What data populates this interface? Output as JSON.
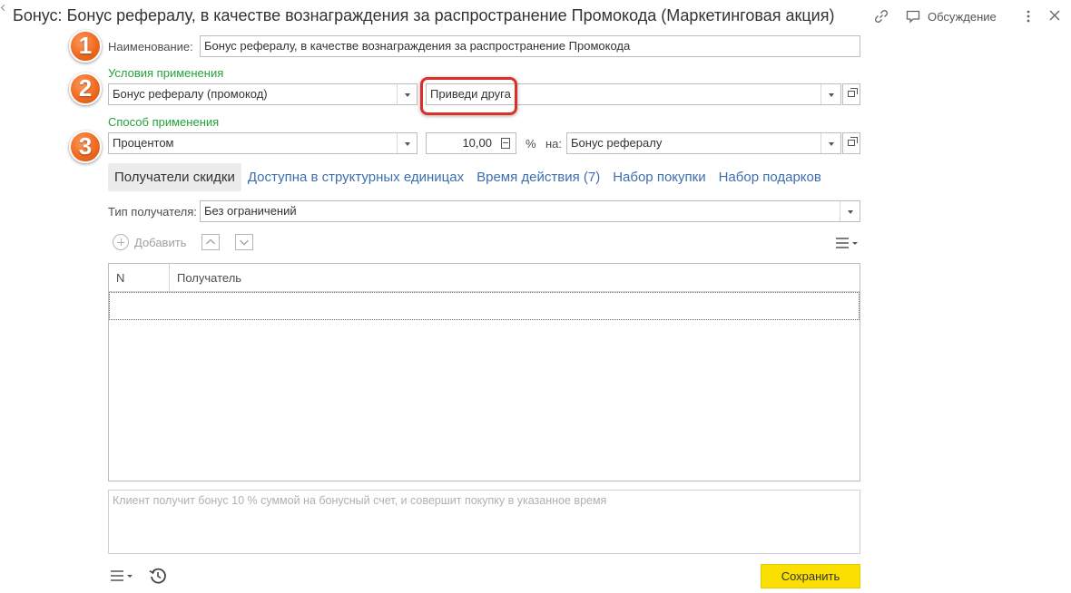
{
  "window": {
    "title": "Бонус: Бонус рефералу, в качестве вознаграждения за распространение Промокода (Маркетинговая акция)",
    "discuss_label": "Обсуждение"
  },
  "badges": [
    "1",
    "2",
    "3"
  ],
  "form": {
    "name_label": "Наименование:",
    "name_value": "Бонус рефералу, в качестве вознаграждения за распространение Промокода",
    "conditions_label": "Условия применения",
    "condition_type": "Бонус рефералу (промокод)",
    "condition_value": "Приведи друга",
    "method_label": "Способ применения",
    "method_value": "Процентом",
    "amount_value": "10,00",
    "percent_sign": "%",
    "on_label": "на:",
    "bonus_target": "Бонус рефералу"
  },
  "tabs": [
    {
      "label": "Получатели скидки",
      "active": true
    },
    {
      "label": "Доступна в структурных единицах",
      "active": false
    },
    {
      "label": "Время действия (7)",
      "active": false
    },
    {
      "label": "Набор покупки",
      "active": false
    },
    {
      "label": "Набор подарков",
      "active": false
    }
  ],
  "recipients": {
    "type_label": "Тип получателя:",
    "type_value": "Без ограничений",
    "add_label": "Добавить",
    "columns": [
      "N",
      "Получатель"
    ],
    "rows": []
  },
  "comment_placeholder": "Клиент получит бонус 10 % суммой на бонусный счет, и совершит покупку в указанное время",
  "save_label": "Сохранить",
  "colors": {
    "accent_green": "#26a13b",
    "link_blue": "#3d6fb0",
    "badge_orange": "#f06a20",
    "highlight_red": "#d9302a",
    "save_yellow": "#fadf00"
  }
}
